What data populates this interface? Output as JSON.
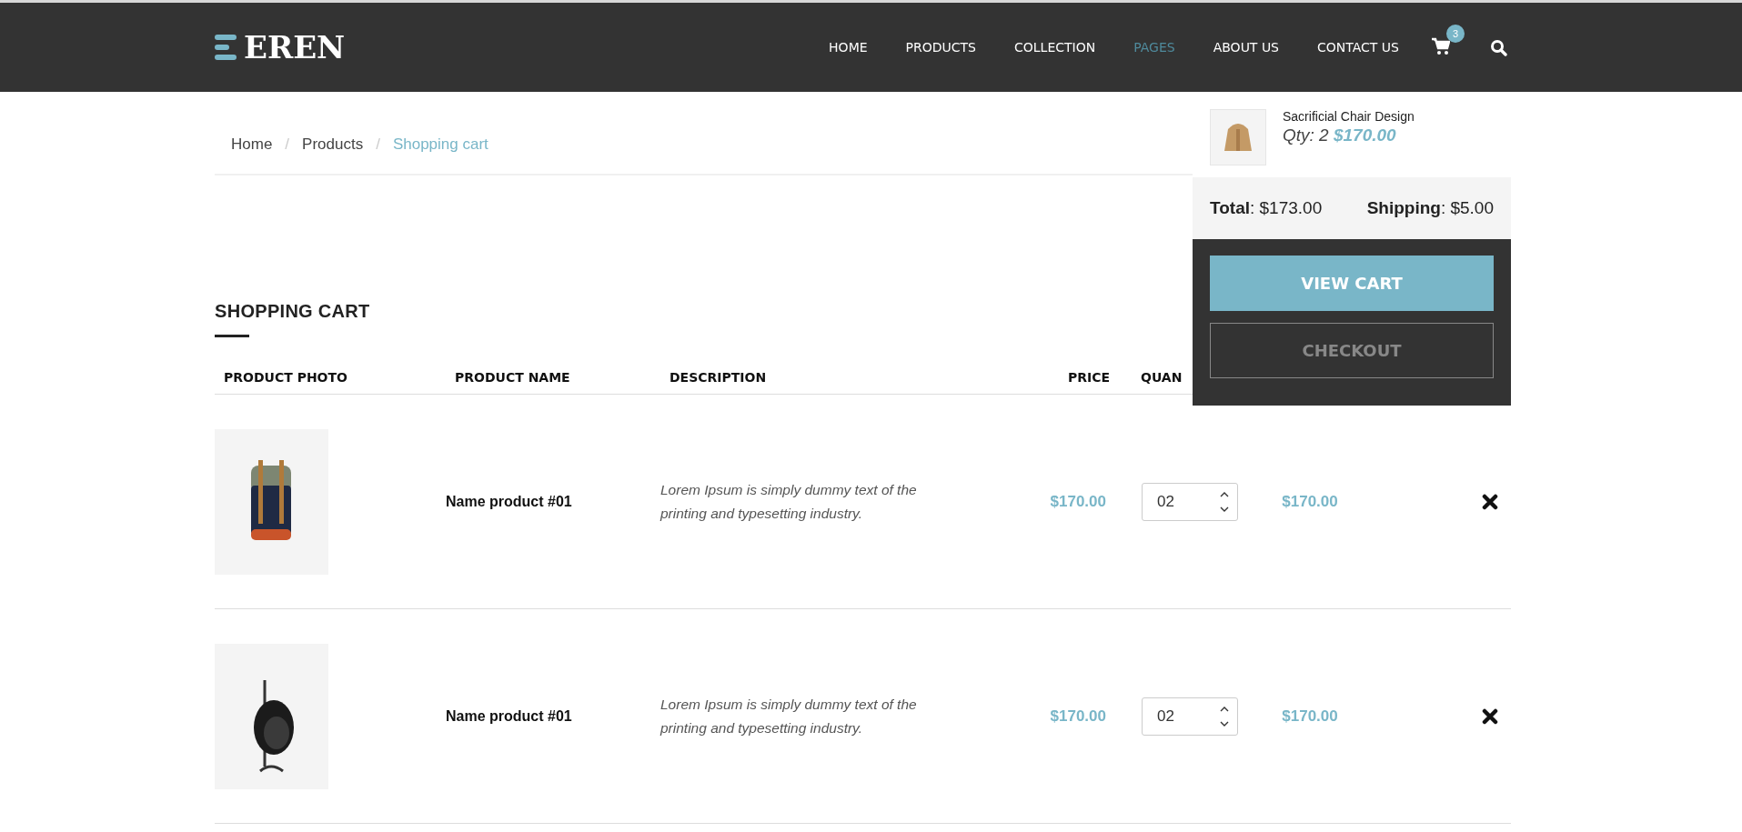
{
  "logo": {
    "text": "EREN"
  },
  "nav": [
    {
      "label": "HOME",
      "selected": false
    },
    {
      "label": "PRODUCTS",
      "selected": false
    },
    {
      "label": "COLLECTION",
      "selected": false
    },
    {
      "label": "PAGES",
      "selected": true
    },
    {
      "label": "ABOUT US",
      "selected": false
    },
    {
      "label": "CONTACT US",
      "selected": false
    }
  ],
  "cart_badge": "3",
  "breadcrumb": {
    "items": [
      {
        "label": "Home",
        "selected": false
      },
      {
        "label": "Products",
        "selected": false
      },
      {
        "label": "Shopping cart",
        "selected": true
      }
    ],
    "separators": [
      "/",
      "/"
    ]
  },
  "section_title": "SHOPPING CART",
  "table": {
    "columns": [
      "PRODUCT PHOTO",
      "PRODUCT NAME",
      "DESCRIPTION",
      "PRICE",
      "QUAN"
    ],
    "rows": [
      {
        "name": "Name product #01",
        "description": "Lorem Ipsum is simply dummy text of the printing and typesetting industry.",
        "price": "$170.00",
        "quantity": "02",
        "total": "$170.00"
      },
      {
        "name": "Name product #01",
        "description": "Lorem Ipsum is simply dummy text of the printing and typesetting industry.",
        "price": "$170.00",
        "quantity": "02",
        "total": "$170.00"
      }
    ]
  },
  "mini_cart": {
    "items": [
      {
        "name": "Sacrificial Chair Design",
        "qty": "Qty: 2",
        "price": "$170.00"
      }
    ],
    "total": "**Total**: $173.00",
    "shipping": "**Shipping**: $5.00",
    "buttons": [
      {
        "label": "VIEW CART",
        "kind": "primary"
      },
      {
        "label": "CHECKOUT",
        "kind": "outline"
      }
    ]
  }
}
